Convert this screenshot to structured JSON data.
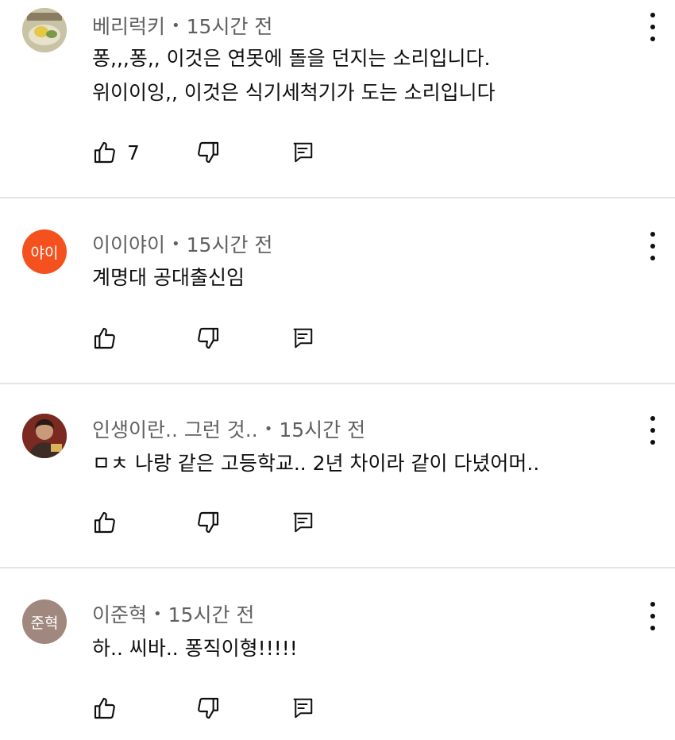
{
  "comments": [
    {
      "author": "베리럭키",
      "time": "15시간 전",
      "avatar_text": "",
      "avatar_color": "#9aa05a",
      "lines": [
        "퐁,,,퐁,, 이것은 연못에 돌을 던지는 소리입니다.",
        "위이이잉,, 이것은 식기세척기가 도는 소리입니다"
      ],
      "likes": "7"
    },
    {
      "author": "이이야이",
      "time": "15시간 전",
      "avatar_text": "야이",
      "avatar_color": "#f4511e",
      "lines": [
        "계명대 공대출신임"
      ],
      "likes": ""
    },
    {
      "author": "인생이란.. 그런 것..",
      "time": "15시간 전",
      "avatar_text": "",
      "avatar_color": "#6d2a22",
      "lines": [
        "ㅁㅊ 나랑 같은 고등학교.. 2년 차이라 같이 다녔어머.."
      ],
      "likes": ""
    },
    {
      "author": "이준혁",
      "time": "15시간 전",
      "avatar_text": "준혁",
      "avatar_color": "#a1887f",
      "lines": [
        "하.. 씨바.. 퐁직이형!!!!!"
      ],
      "likes": ""
    }
  ],
  "dot": "•",
  "icons": {
    "like": "thumb-up-icon",
    "dislike": "thumb-down-icon",
    "reply": "reply-icon",
    "more": "more-vert-icon"
  }
}
